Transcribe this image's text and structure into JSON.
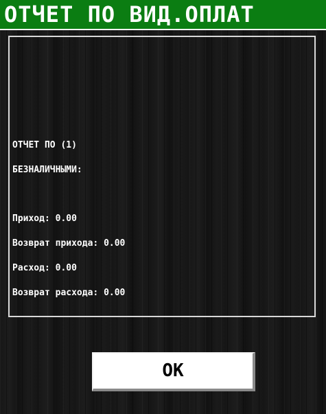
{
  "window": {
    "title": "ОТЧЕТ ПО ВИД.ОПЛАТ"
  },
  "report": {
    "heading_line1": "ОТЧЕТ ПО (1)",
    "heading_line2": "БЕЗНАЛИЧНЫМИ:",
    "lines": [
      {
        "label": "Приход:",
        "value": "0.00"
      },
      {
        "label": "Возврат прихода:",
        "value": "0.00"
      },
      {
        "label": "Расход:",
        "value": "0.00"
      },
      {
        "label": "Возврат расхода:",
        "value": "0.00"
      }
    ]
  },
  "buttons": {
    "ok_label": "OK"
  },
  "colors": {
    "title_bar": "#0b7d12",
    "background": "#141414",
    "text": "#ffffff"
  }
}
